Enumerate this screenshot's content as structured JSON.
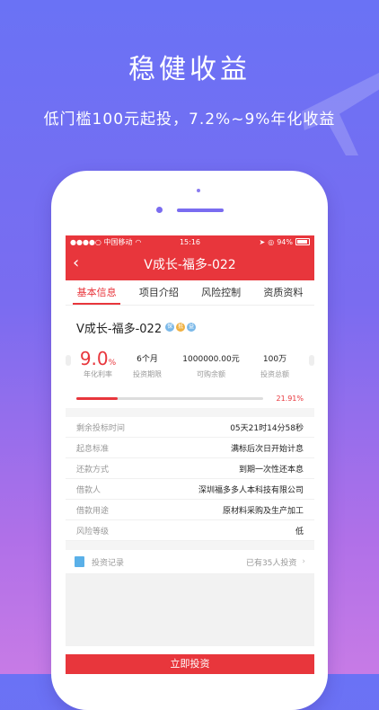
{
  "banner": {
    "title": "稳健收益",
    "subtitle": "低门槛100元起投，7.2%~9%年化收益"
  },
  "statusbar": {
    "carrier": "●●●●○ 中国移动",
    "time": "15:16",
    "battery": "94%"
  },
  "nav": {
    "title": "V成长-福多-022",
    "back_glyph": "‹"
  },
  "tabs": [
    {
      "label": "基本信息",
      "active": true
    },
    {
      "label": "项目介绍",
      "active": false
    },
    {
      "label": "风险控制",
      "active": false
    },
    {
      "label": "资质资料",
      "active": false
    }
  ],
  "product": {
    "name": "V成长-福多-022",
    "badges": [
      {
        "text": "保",
        "color": "#7ab8e8"
      },
      {
        "text": "抵",
        "color": "#f0b040"
      },
      {
        "text": "益",
        "color": "#7ab8e8"
      }
    ]
  },
  "stats": {
    "rate_value": "9.0",
    "rate_unit": "%",
    "rate_label": "年化利率",
    "term_value": "6个月",
    "term_label": "投资期限",
    "available_value": "1000000.00元",
    "available_label": "可购余额",
    "total_value": "100万",
    "total_label": "投资总额"
  },
  "progress": {
    "percent_text": "21.91%",
    "fraction": 0.2191
  },
  "info": [
    {
      "key": "剩余投标时间",
      "value": "05天21时14分58秒"
    },
    {
      "key": "起息标准",
      "value": "满标后次日开始计息"
    },
    {
      "key": "还款方式",
      "value": "到期一次性还本息"
    },
    {
      "key": "借款人",
      "value": "深圳福多多人本科技有限公司"
    },
    {
      "key": "借款用途",
      "value": "原材料采购及生产加工"
    },
    {
      "key": "风险等级",
      "value": "低"
    }
  ],
  "records": {
    "label": "投资记录",
    "count_text": "已有35人投资",
    "chevron": "›"
  },
  "invest_button": "立即投资",
  "colors": {
    "accent": "#e8363c",
    "bg_top": "#6a72f5",
    "bg_bottom": "#c77be6"
  }
}
